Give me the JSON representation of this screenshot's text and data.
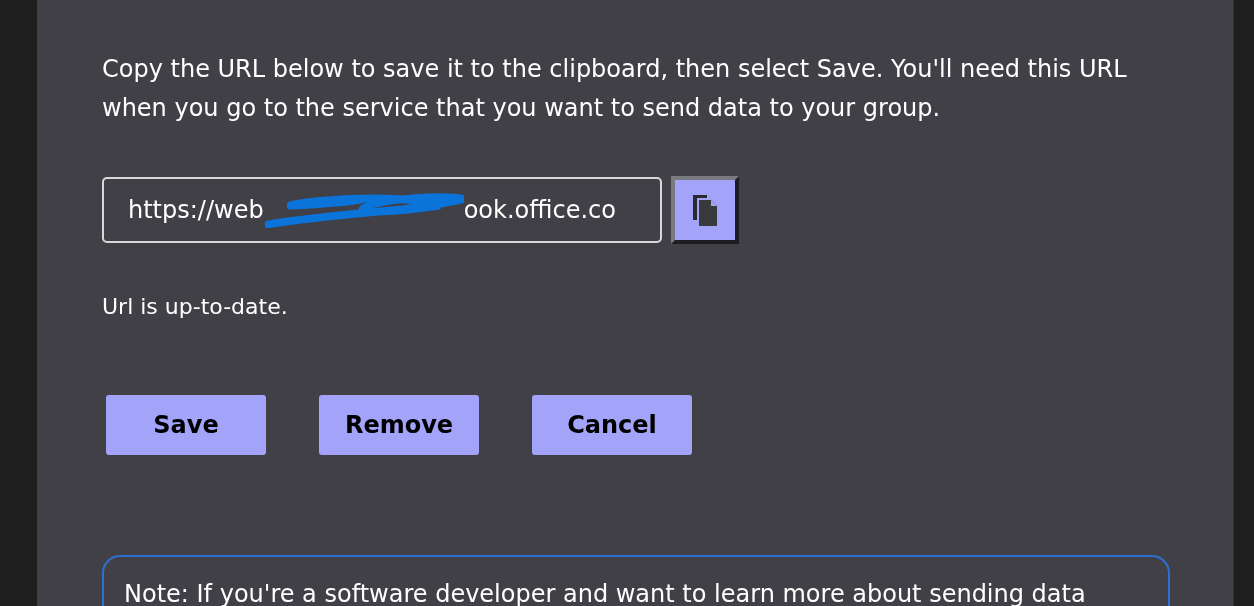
{
  "instructions": "Copy the URL below to save it to the clipboard, then select Save. You'll need this URL when you go to the service that you want to send data to your group.",
  "url_field": {
    "value_start": "https://web",
    "value_end": "ook.office.co",
    "redacted": true
  },
  "copy_button": {
    "kind": "copy"
  },
  "status": "Url is up-to-date.",
  "buttons": [
    {
      "label": "Save"
    },
    {
      "label": "Remove"
    },
    {
      "label": "Cancel"
    }
  ],
  "note": "Note: If you're a software developer and want to learn more about sending data"
}
